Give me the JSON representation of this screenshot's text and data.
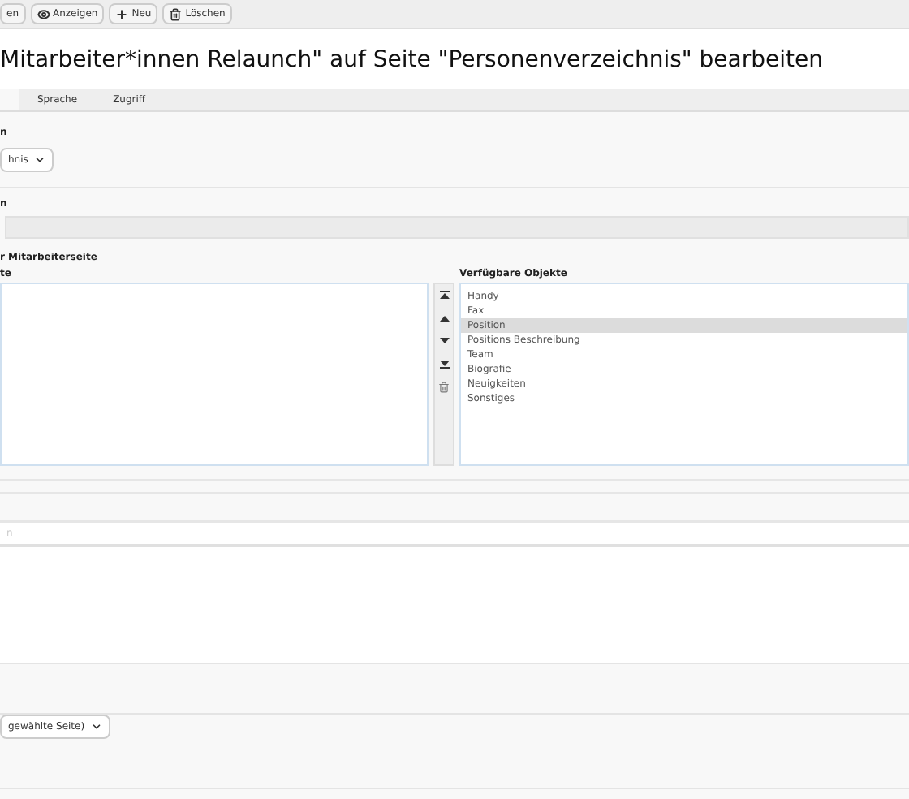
{
  "toolbar": [
    {
      "label": "en",
      "kind": "text"
    },
    {
      "label": "Anzeigen",
      "kind": "eye"
    },
    {
      "label": "Neu",
      "kind": "plus"
    },
    {
      "label": "Löschen",
      "kind": "trash"
    }
  ],
  "title": "Mitarbeiter*innen Relaunch\" auf Seite \"Personenverzeichnis\" bearbeiten",
  "tabs": [
    {
      "selected": true
    },
    {
      "label": "Sprache",
      "selected": false
    },
    {
      "label": "Zugriff",
      "selected": false
    }
  ],
  "section_1": {
    "label": "n",
    "select_value": "hnis"
  },
  "section_2": {
    "label": "n"
  },
  "section_3": {
    "label": "r Mitarbeiterseite",
    "selected_label": "te",
    "available_label": "Verfügbare Objekte",
    "available_items": [
      {
        "label": "Handy",
        "selected": false
      },
      {
        "label": "Fax",
        "selected": false
      },
      {
        "label": "Position",
        "selected": true
      },
      {
        "label": "Positions Beschreibung",
        "selected": false
      },
      {
        "label": "Team",
        "selected": false
      },
      {
        "label": "Biografie",
        "selected": false
      },
      {
        "label": "Neuigkeiten",
        "selected": false
      },
      {
        "label": "Sonstiges",
        "selected": false
      }
    ]
  },
  "search_field": {
    "placeholder": "n"
  },
  "bottom_select": {
    "value": "gewählte Seite)"
  }
}
